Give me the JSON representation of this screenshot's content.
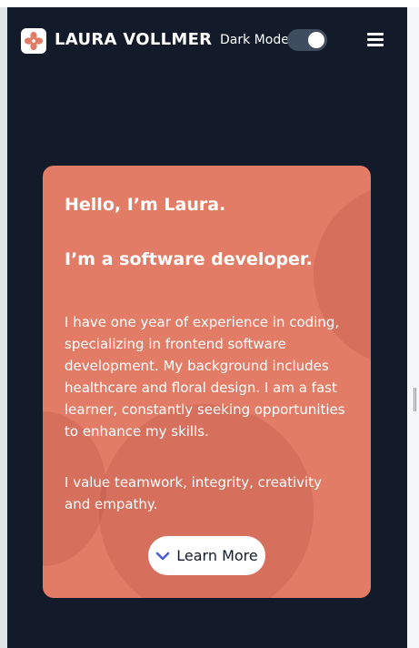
{
  "navbar": {
    "brand": "LAURA VOLLMER",
    "logo_icon": "flower-icon",
    "dark_mode_label": "Dark Mode",
    "dark_mode_on": true,
    "menu_icon": "hamburger-menu-icon"
  },
  "hero": {
    "greeting": "Hello, I’m Laura.",
    "role": "I’m a software developer.",
    "bio": "I have one year of experience in coding, specializing in frontend software development. My background includes healthcare and floral design. I am a fast learner, constantly seeking opportunities to enhance my skills.",
    "values": "I value teamwork, integrity, creativity and empathy.",
    "cta_label": "Learn More",
    "cta_icon": "chevron-down-icon"
  },
  "colors": {
    "background": "#131a29",
    "card": "#e37c66",
    "accent_chevron": "#4a5fd8",
    "toggle_track": "#3f4d61"
  }
}
